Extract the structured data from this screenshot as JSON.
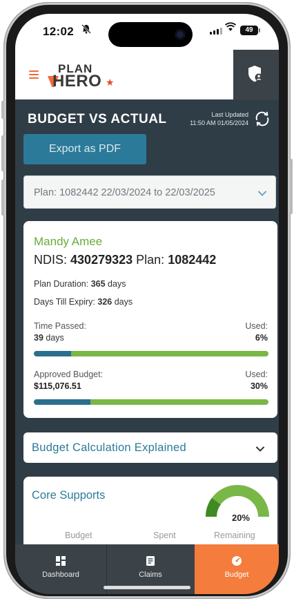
{
  "status": {
    "time": "12:02",
    "battery": "49"
  },
  "header": {
    "logo_top": "PLAN",
    "logo_bottom": "HERO"
  },
  "page": {
    "title": "BUDGET VS ACTUAL",
    "last_updated_label": "Last Updated",
    "last_updated_value": "11:50 AM 01/05/2024",
    "export_label": "Export as PDF",
    "plan_select_value": "Plan: 1082442 22/03/2024 to 22/03/2025"
  },
  "summary": {
    "name": "Mandy Amee",
    "ndis_label": "NDIS:",
    "ndis_number": "430279323",
    "plan_label": "Plan:",
    "plan_number": "1082442",
    "duration_label": "Plan Duration:",
    "duration_value": "365",
    "duration_unit": "days",
    "expiry_label": "Days Till Expiry:",
    "expiry_value": "326",
    "expiry_unit": "days",
    "time_passed_label": "Time Passed:",
    "time_passed_value": "39",
    "time_passed_unit": "days",
    "time_used_label": "Used:",
    "time_used_pct": "6%",
    "time_used_fraction": 0.16,
    "budget_label": "Approved Budget:",
    "budget_value": "$115,076.51",
    "budget_used_label": "Used:",
    "budget_used_pct": "30%",
    "budget_used_fraction": 0.24
  },
  "explained": {
    "label": "Budget Calculation Explained"
  },
  "core": {
    "title": "Core Supports",
    "gauge_pct": "20%",
    "gauge_fraction": 0.2,
    "col_budget": "Budget",
    "col_spent": "Spent",
    "col_remaining": "Remaining"
  },
  "tabs": [
    {
      "label": "Dashboard",
      "icon": "dashboard-icon"
    },
    {
      "label": "Claims",
      "icon": "claims-icon"
    },
    {
      "label": "Budget",
      "icon": "budget-gauge-icon"
    }
  ],
  "colors": {
    "accent_orange": "#f47c3c",
    "teal": "#2b7a99",
    "green": "#6aab3c",
    "dark_bg": "#2f3d47"
  }
}
